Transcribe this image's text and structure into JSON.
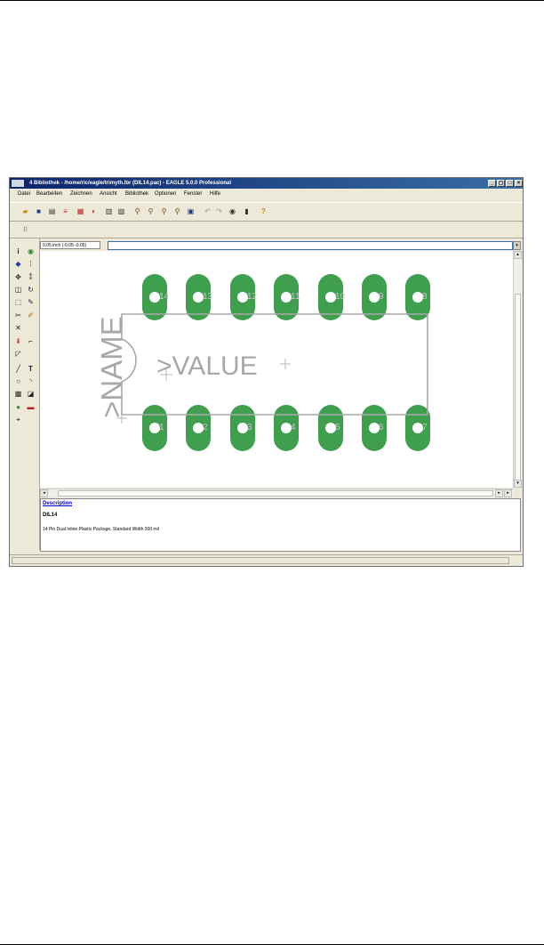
{
  "window": {
    "title": "4 Bibliothek - /home/ric/eagle/trimyth.lbr (DIL14.pac) - EAGLE 5.0.0 Professional",
    "controls": {
      "minimize": "_",
      "maximize": "□",
      "restore": "◻",
      "close": "×"
    }
  },
  "menu": {
    "items": [
      "Datei",
      "Bearbeiten",
      "Zeichnen",
      "Ansicht",
      "Bibliothek",
      "Optionen",
      "Fenster",
      "Hilfe"
    ]
  },
  "toolbar": {
    "icons": [
      "open-icon",
      "save-icon",
      "print-icon",
      "cam-icon",
      "drc-icon",
      "erc-icon",
      "script-icon",
      "ulp-icon",
      "zoom-fit-icon",
      "zoom-in-icon",
      "zoom-out-icon",
      "zoom-redraw-icon",
      "zoom-select-icon",
      "undo-icon",
      "redo-icon",
      "stop-icon",
      "go-icon",
      "help-icon"
    ]
  },
  "coordinates": {
    "text": "0.05 inch (-0.05 -0.05)"
  },
  "command_line": {
    "value": "",
    "dropdown_icon": "▾"
  },
  "package": {
    "name_label": ">NAME",
    "value_label": ">VALUE",
    "pad_color": "#3f9f4f",
    "outline_color": "#a8a8a8",
    "top_pads": [
      "14",
      "13",
      "12",
      "11",
      "10",
      "9",
      "8"
    ],
    "bottom_pads": [
      "1",
      "2",
      "3",
      "4",
      "5",
      "6",
      "7"
    ]
  },
  "description": {
    "heading": "Description",
    "package_name": "DIL14",
    "text": "14 Pin Dual Inline Plastic Package, Standard Width 300 mil"
  },
  "colors": {
    "titlebar": "#0a246a",
    "window_bg": "#ece9d8",
    "pad": "#3f9f4f"
  }
}
